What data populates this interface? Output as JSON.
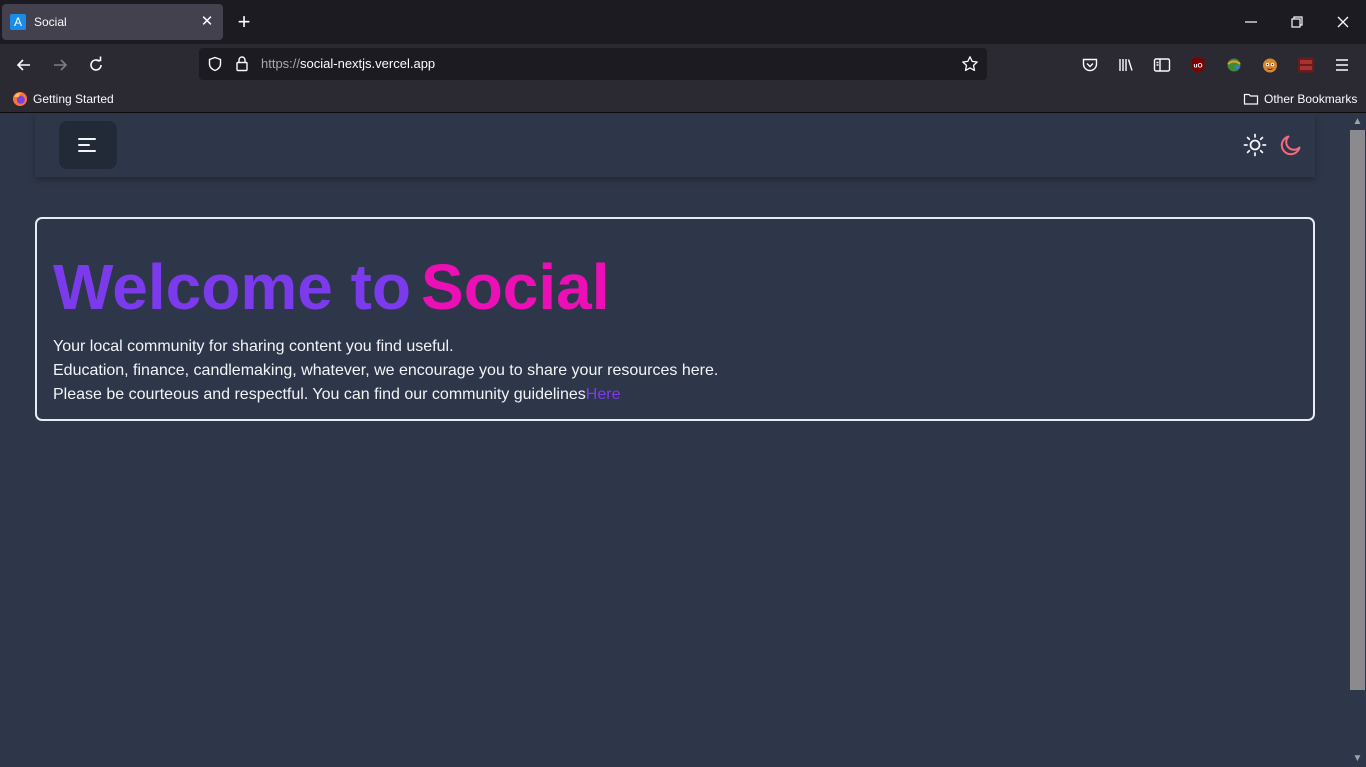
{
  "browser": {
    "tab": {
      "favicon_letter": "A",
      "title": "Social"
    },
    "url": {
      "protocol": "https://",
      "host": "social-nextjs.vercel.app"
    },
    "bookmarks": {
      "getting_started": "Getting Started",
      "other": "Other Bookmarks"
    },
    "extensions": [
      "pocket-icon",
      "library-icon",
      "sidebar-icon",
      "ublock-icon",
      "extension-globe-icon",
      "tampermonkey-icon",
      "cors-extension-icon"
    ]
  },
  "page": {
    "title_part1": "Welcome to",
    "title_part2": "Social",
    "lines": [
      "Your local community for sharing content you find useful.",
      "Education, finance, candlemaking, whatever, we encourage you to share your resources here.",
      "Please be courteous and respectful. You can find our community guidelines"
    ],
    "guidelines_link": "Here"
  },
  "colors": {
    "accent_purple": "#7c3aed",
    "accent_pink": "#ec0fb6",
    "background": "#2e3649",
    "moon": "#f56b7d"
  }
}
